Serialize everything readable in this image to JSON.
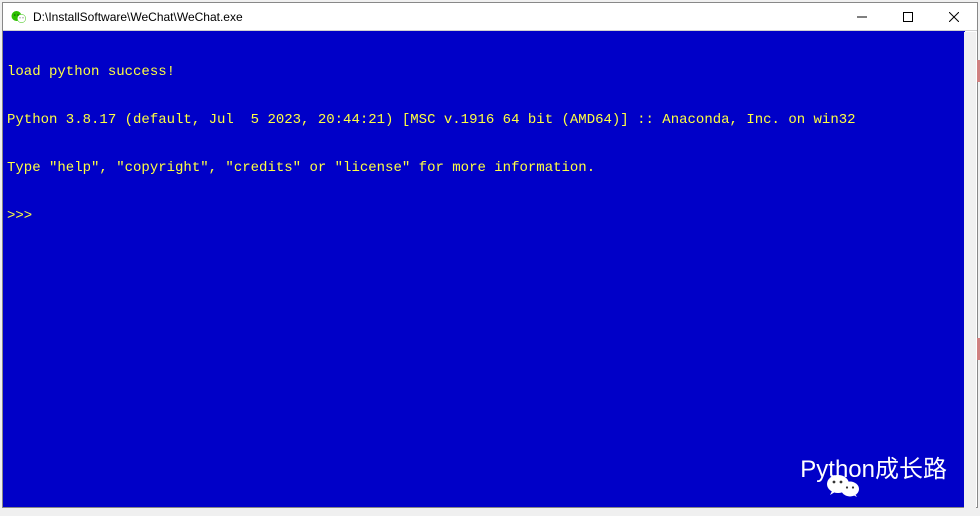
{
  "window": {
    "title": "D:\\InstallSoftware\\WeChat\\WeChat.exe"
  },
  "terminal": {
    "line1": "load python success!",
    "line2": "Python 3.8.17 (default, Jul  5 2023, 20:44:21) [MSC v.1916 64 bit (AMD64)] :: Anaconda, Inc. on win32",
    "line3": "Type \"help\", \"copyright\", \"credits\" or \"license\" for more information.",
    "line4": ">>> "
  },
  "watermark": {
    "text": "Python成长路"
  },
  "colors": {
    "terminal_bg": "#0000c8",
    "terminal_fg": "#ffff40"
  }
}
